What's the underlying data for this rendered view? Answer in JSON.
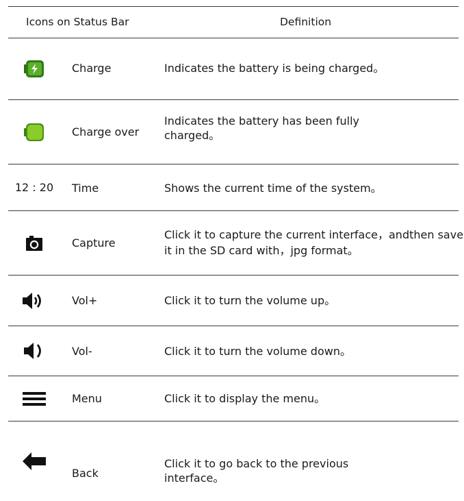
{
  "header": {
    "col_icons": "Icons on Status Bar",
    "col_definition": "Definition"
  },
  "rows": [
    {
      "icon": "battery-charging-icon",
      "icon_color": "#3c8a1e",
      "name": "Charge",
      "definition": "Indicates the battery is being charged。"
    },
    {
      "icon": "battery-full-icon",
      "icon_color": "#7ec21d",
      "name": "Charge over",
      "definition": "Indicates the battery has been fully charged。"
    },
    {
      "icon_text": "12 : 20",
      "name": "Time",
      "definition": "Shows the current time of the system。"
    },
    {
      "icon": "camera-icon",
      "name": "Capture",
      "definition": "Click it to capture the current interface，andthen save it in the SD card with，jpg format。"
    },
    {
      "icon": "volume-up-icon",
      "name": "Vol+",
      "definition": "Click it to turn the volume up。"
    },
    {
      "icon": "volume-down-icon",
      "name": "Vol-",
      "definition": "Click it to turn the volume down。"
    },
    {
      "icon": "menu-icon",
      "name": "Menu",
      "definition": "Click it to display the menu。"
    },
    {
      "icon": "back-arrow-icon",
      "name": "Back",
      "definition": "Click it to go back to the previous interface。"
    }
  ]
}
